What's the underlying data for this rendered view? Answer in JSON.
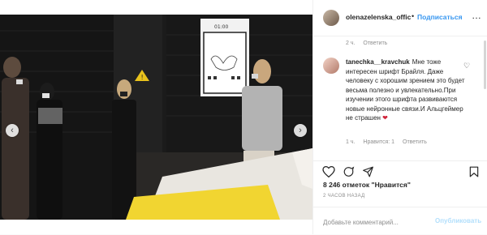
{
  "post": {
    "photo": {
      "panel_top_text": "01:00",
      "nav_prev_icon": "chevron-left",
      "nav_next_icon": "chevron-right",
      "slides_count": 3,
      "active_slide_index": 0
    },
    "header": {
      "username": "olenazelenska_offic",
      "separator": "•",
      "follow_label": "Подписаться",
      "more_icon": "ellipsis"
    },
    "prev_comment_meta": {
      "time": "2 ч.",
      "reply_label": "Ответить"
    },
    "comment": {
      "author": "tanechka__kravchuk",
      "text": "Мне тоже интересен шрифт Брайля. Даже человеку с хорошим зрением это будет весьма полезно и увлекательно.При изучении этого шрифта развиваются новые нейронные связи.И Альцгеймер не страшен",
      "emoji": "heart",
      "time": "1 ч.",
      "likes_label": "Нравится: 1",
      "reply_label": "Ответить"
    },
    "actions": {
      "like_icon": "heart-outline",
      "comment_icon": "speech-bubble",
      "share_icon": "paper-plane",
      "save_icon": "bookmark"
    },
    "likes_text": "8 246 отметок \"Нравится\"",
    "timestamp": "2 ЧАСОВ НАЗАД",
    "add_comment": {
      "placeholder": "Добавьте комментарий...",
      "publish_label": "Опубликовать"
    },
    "colors": {
      "link_blue": "#3897f0",
      "publish_disabled": "#b2dffc",
      "muted": "#8e8e8e"
    }
  }
}
